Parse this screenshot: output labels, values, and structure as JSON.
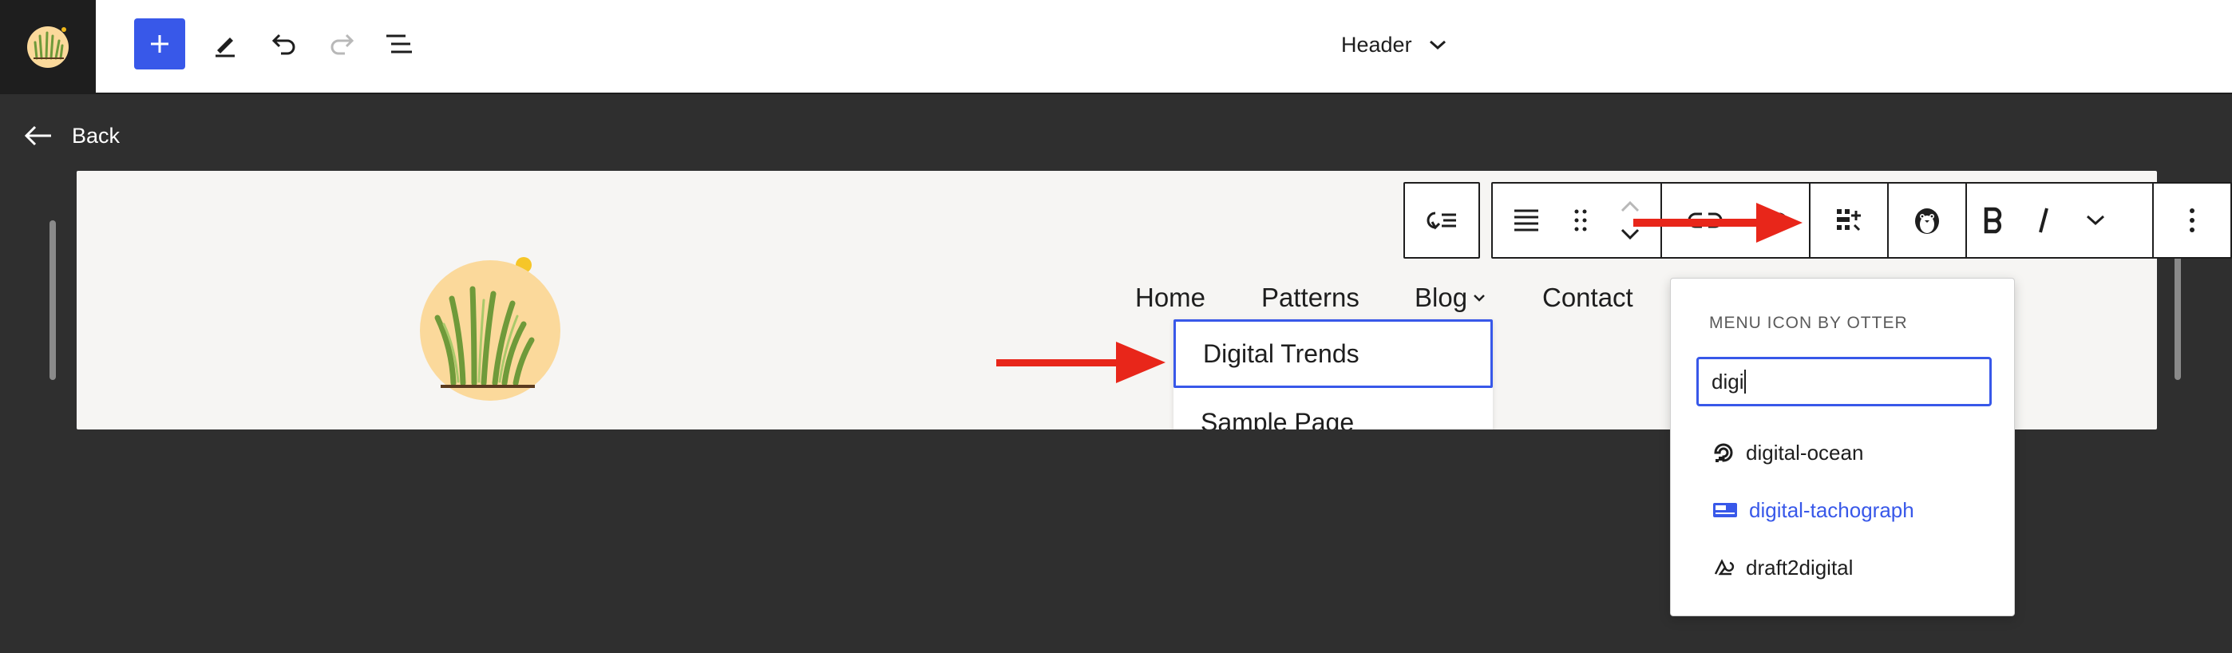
{
  "topbar": {
    "document_title": "Header",
    "icons": [
      "grass-logo-icon",
      "plus-icon",
      "pencil-icon",
      "undo-icon",
      "redo-icon",
      "list-view-icon",
      "chevron-down-icon"
    ]
  },
  "back": {
    "label": "Back"
  },
  "canvas": {
    "nav": {
      "items": [
        "Home",
        "Patterns",
        "Blog",
        "Contact"
      ]
    },
    "submenu": {
      "items": [
        "Digital Trends",
        "Sample Page"
      ]
    }
  },
  "toolbar": {
    "icons": [
      "submenu-toggle-icon",
      "align-icon",
      "drag-handle-icon",
      "move-up-down-icon",
      "link-icon",
      "unlink-icon",
      "menu-icon-block-icon",
      "otter-penguin-icon",
      "bold-icon",
      "italic-icon",
      "more-chevron-icon",
      "options-kebab-icon"
    ]
  },
  "popover": {
    "heading": "MENU ICON BY OTTER",
    "search_value": "digi",
    "results": [
      {
        "label": "digital-ocean",
        "icon": "digital-ocean-icon"
      },
      {
        "label": "digital-tachograph",
        "icon": "digital-tachograph-icon",
        "active": true
      },
      {
        "label": "draft2digital",
        "icon": "draft2digital-icon"
      }
    ]
  },
  "colors": {
    "accent": "#3858e9",
    "annotation_arrow": "#e8261a",
    "dark_bg": "#2f2f2f"
  }
}
